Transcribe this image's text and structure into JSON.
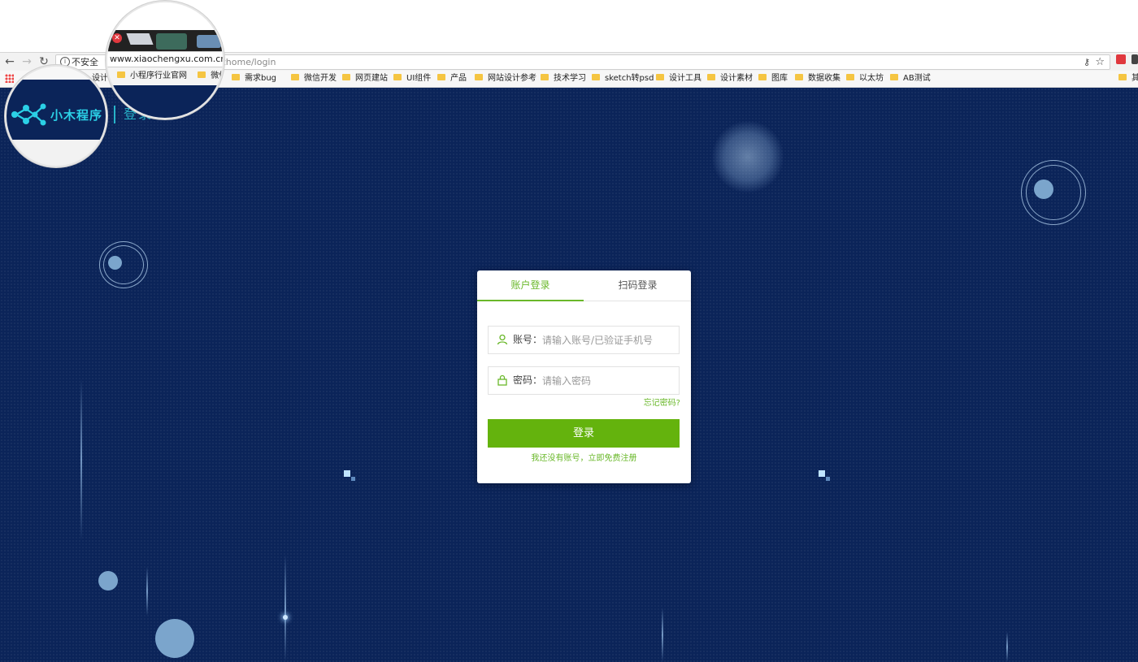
{
  "browser": {
    "security_label": "不安全",
    "url_visible_tail": "zhome/login",
    "url_magnified": "www.xiaochengxu.com.cn",
    "bookmarks": [
      "设计",
      "小程序行业官网",
      "微信支付",
      "需求bug",
      "微信开发",
      "网页建站",
      "UI组件",
      "产品",
      "网站设计参考",
      "技术学习",
      "sketch转psd",
      "设计工具",
      "设计素材",
      "图库",
      "数据收集",
      "以太坊",
      "AB测试",
      "其"
    ]
  },
  "header": {
    "logo_text": "小木程序",
    "subtitle": "登录"
  },
  "login": {
    "tabs": [
      "账户登录",
      "扫码登录"
    ],
    "active_tab": "账户登录",
    "account_label": "账号：",
    "account_placeholder": "请输入账号/已验证手机号",
    "password_label": "密码：",
    "password_placeholder": "请输入密码",
    "forgot": "忘记密码?",
    "submit": "登录",
    "register": "我还没有账号，立即免费注册"
  },
  "icons": {
    "user": "user-icon",
    "lock": "lock-icon",
    "logo": "molecule-logo-icon"
  },
  "colors": {
    "accent_green": "#64b30d",
    "background_navy": "#0b2459",
    "logo_cyan": "#2bd0e6"
  }
}
